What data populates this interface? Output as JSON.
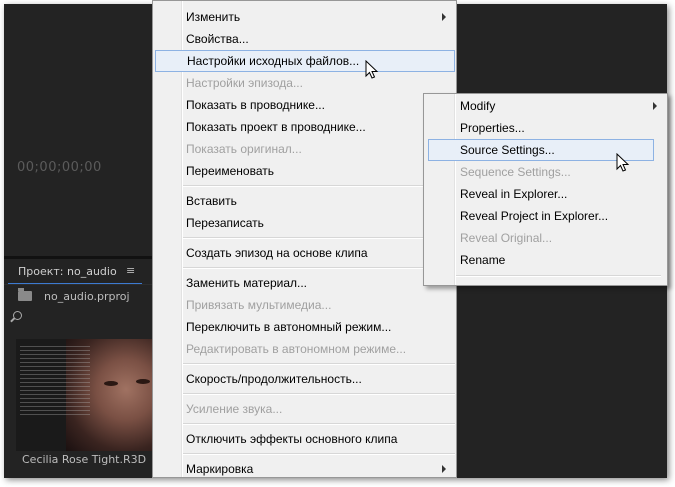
{
  "app": {
    "timecode": "00;00;00;00",
    "project_tab": "Проект: no_audio",
    "project_tab_menu_icon": "hamburger-icon",
    "project_file": "no_audio.prproj",
    "clip_name": "Cecilia Rose Tight.R3D"
  },
  "menu_ru": {
    "items": [
      {
        "label": "Изменить",
        "submenu": true,
        "disabled": false
      },
      {
        "label": "Свойства...",
        "disabled": false
      },
      {
        "label": "Настройки исходных файлов...",
        "disabled": false,
        "highlighted": true
      },
      {
        "label": "Настройки эпизода...",
        "disabled": true
      },
      {
        "label": "Показать в проводнике...",
        "disabled": false
      },
      {
        "label": "Показать проект в проводнике...",
        "disabled": false
      },
      {
        "label": "Показать оригинал...",
        "disabled": true
      },
      {
        "label": "Переименовать",
        "disabled": false
      },
      {
        "label": "Вставить",
        "disabled": false
      },
      {
        "label": "Перезаписать",
        "disabled": false
      },
      {
        "label": "Создать эпизод на основе клипа",
        "disabled": false
      },
      {
        "label": "Заменить материал...",
        "disabled": false
      },
      {
        "label": "Привязать мультимедиа...",
        "disabled": true
      },
      {
        "label": "Переключить в автономный режим...",
        "disabled": false
      },
      {
        "label": "Редактировать в автономном режиме...",
        "disabled": true
      },
      {
        "label": "Скорость/продолжительность...",
        "disabled": false
      },
      {
        "label": "Усиление звука...",
        "disabled": true
      },
      {
        "label": "Отключить эффекты основного клипа",
        "disabled": false
      },
      {
        "label": "Маркировка",
        "submenu": true,
        "disabled": false
      }
    ]
  },
  "menu_en": {
    "items": [
      {
        "label": "Modify",
        "submenu": true,
        "disabled": false
      },
      {
        "label": "Properties...",
        "disabled": false
      },
      {
        "label": "Source Settings...",
        "disabled": false,
        "highlighted": true
      },
      {
        "label": "Sequence Settings...",
        "disabled": true
      },
      {
        "label": "Reveal in Explorer...",
        "disabled": false
      },
      {
        "label": "Reveal Project in Explorer...",
        "disabled": false
      },
      {
        "label": "Reveal Original...",
        "disabled": true
      },
      {
        "label": "Rename",
        "disabled": false
      }
    ]
  },
  "colors": {
    "panel_bg": "#232323",
    "menu_bg": "#f0f0f0",
    "highlight_bg": "#e8eff8",
    "highlight_border": "#8db2e3",
    "disabled_text": "#a0a0a0",
    "tab_underline": "#3c7ad1"
  }
}
